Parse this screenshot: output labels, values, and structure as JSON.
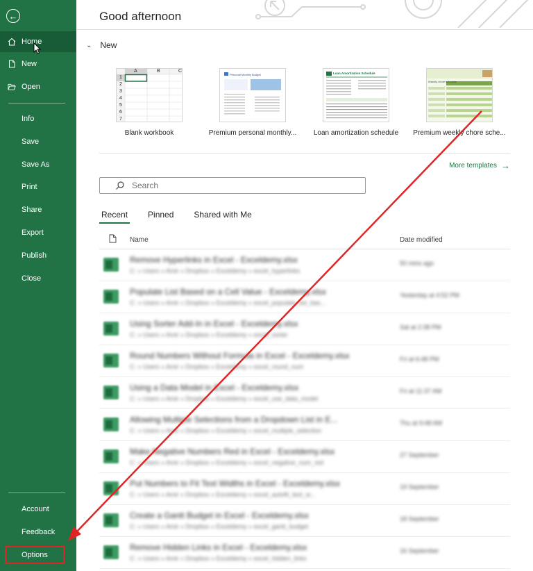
{
  "sidebar": {
    "back_icon": "back-arrow-icon",
    "items": [
      {
        "label": "Home",
        "icon": "home-icon"
      },
      {
        "label": "New",
        "icon": "new-document-icon"
      },
      {
        "label": "Open",
        "icon": "folder-open-icon"
      },
      {
        "label": "Info"
      },
      {
        "label": "Save"
      },
      {
        "label": "Save As"
      },
      {
        "label": "Print"
      },
      {
        "label": "Share"
      },
      {
        "label": "Export"
      },
      {
        "label": "Publish"
      },
      {
        "label": "Close"
      }
    ],
    "bottom_items": [
      {
        "label": "Account"
      },
      {
        "label": "Feedback"
      },
      {
        "label": "Options"
      }
    ]
  },
  "main": {
    "greeting": "Good afternoon",
    "new_section": "New",
    "templates": [
      {
        "name": "Blank workbook"
      },
      {
        "name": "Premium personal monthly..."
      },
      {
        "name": "Loan amortization schedule"
      },
      {
        "name": "Premium weekly chore sche..."
      }
    ],
    "template_thumb_text": {
      "blank_cols": [
        "A",
        "B",
        "C"
      ],
      "blank_rows": [
        "1",
        "2",
        "3",
        "4",
        "5",
        "6",
        "7"
      ],
      "budget_title": "Personal Monthly Budget",
      "loan_title": "Loan Amortization Schedule",
      "chore_title": "Weekly chore schedule"
    },
    "more_templates": "More templates",
    "search_placeholder": "Search",
    "tabs": [
      "Recent",
      "Pinned",
      "Shared with Me"
    ],
    "list_header": {
      "name": "Name",
      "date": "Date modified"
    },
    "files": [
      {
        "name": "Remove Hyperlinks in Excel - Exceldemy.xlsx",
        "path": "C: » Users » Amir » Dropbox » Exceldemy » excel_hyperlinks",
        "date": "50 mins ago"
      },
      {
        "name": "Populate List Based on a Cell Value - Exceldemy.xlsx",
        "path": "C: » Users » Amir » Dropbox » Exceldemy » excel_populate_list_bas...",
        "date": "Yesterday at 4:52 PM"
      },
      {
        "name": "Using Sorter Add-In in Excel - Exceldemy.xlsx",
        "path": "C: » Users » Amir » Dropbox » Exceldemy » excel_sorter",
        "date": "Sat at 2:38 PM"
      },
      {
        "name": "Round Numbers Without Formula in Excel - Exceldemy.xlsx",
        "path": "C: » Users » Amir » Dropbox » Exceldemy » excel_round_num",
        "date": "Fri at 6:48 PM"
      },
      {
        "name": "Using a Data Model in Excel - Exceldemy.xlsx",
        "path": "C: » Users » Amir » Dropbox » Exceldemy » excel_use_data_model",
        "date": "Fri at 11:37 AM"
      },
      {
        "name": "Allowing Multiple Selections from a Dropdown List in E...",
        "path": "C: » Users » Amir » Dropbox » Exceldemy » excel_multiple_selection",
        "date": "Thu at 9:48 AM"
      },
      {
        "name": "Make Negative Numbers Red in Excel - Exceldemy.xlsx",
        "path": "C: » Users » Amir » Dropbox » Exceldemy » excel_negative_num_red",
        "date": "27 September"
      },
      {
        "name": "Put Numbers to Fit Text Widths in Excel - Exceldemy.xlsx",
        "path": "C: » Users » Amir » Dropbox » Exceldemy » excel_autofit_text_w...",
        "date": "19 September"
      },
      {
        "name": "Create a Gantt Budget in Excel - Exceldemy.xlsx",
        "path": "C: » Users » Amir » Dropbox » Exceldemy » excel_gantt_budget",
        "date": "18 September"
      },
      {
        "name": "Remove Hidden Links in Excel - Exceldemy.xlsx",
        "path": "C: » Users » Amir » Dropbox » Exceldemy » excel_hidden_links",
        "date": "16 September"
      }
    ]
  },
  "colors": {
    "sidebar_bg": "#217346",
    "sidebar_active": "#185c37",
    "accent": "#217346",
    "annotation": "#e02424"
  }
}
